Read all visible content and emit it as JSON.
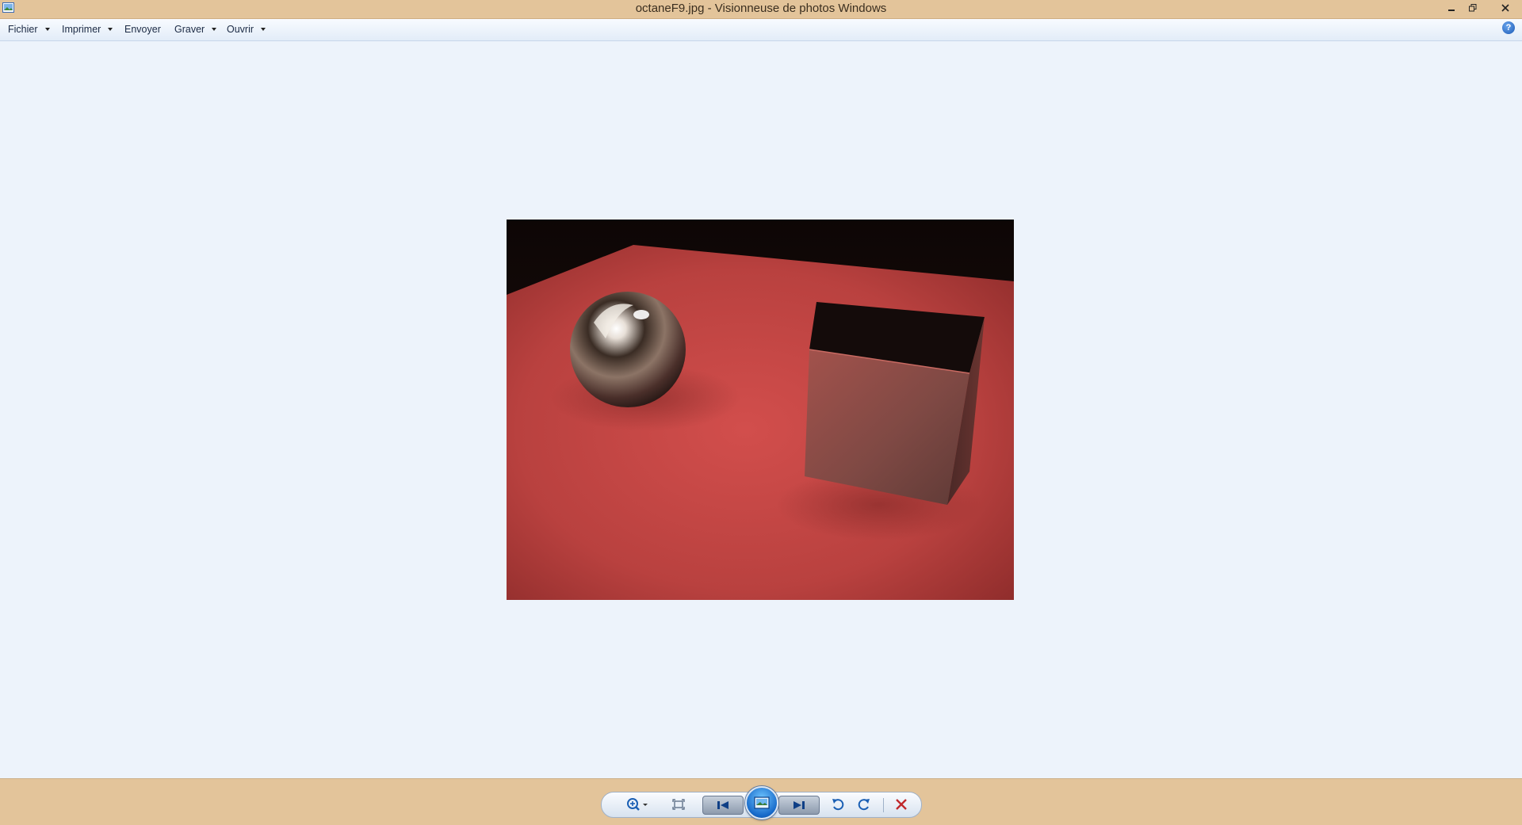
{
  "window": {
    "title": "octaneF9.jpg - Visionneuse de photos Windows",
    "icons": {
      "app": "photo-viewer-icon",
      "minimize": "minimize-icon",
      "maximize": "restore-icon",
      "close": "close-icon"
    }
  },
  "menu": {
    "items": [
      {
        "label": "Fichier",
        "has_dropdown": true
      },
      {
        "label": "Imprimer",
        "has_dropdown": true
      },
      {
        "label": "Envoyer",
        "has_dropdown": false
      },
      {
        "label": "Graver",
        "has_dropdown": true
      },
      {
        "label": "Ouvrir",
        "has_dropdown": true
      }
    ],
    "help": "?"
  },
  "photo": {
    "file": "octaneF9.jpg",
    "content": "render-scene-red-plane-chrome-sphere-cube"
  },
  "toolbar": {
    "buttons": [
      {
        "name": "zoom",
        "icon": "magnifier-icon"
      },
      {
        "name": "actual-size",
        "icon": "fit-window-icon"
      },
      {
        "name": "previous",
        "icon": "previous-icon"
      },
      {
        "name": "slideshow",
        "icon": "slideshow-icon"
      },
      {
        "name": "next",
        "icon": "next-icon"
      },
      {
        "name": "rotate-left",
        "icon": "rotate-ccw-icon"
      },
      {
        "name": "rotate-right",
        "icon": "rotate-cw-icon"
      },
      {
        "name": "delete",
        "icon": "delete-icon"
      }
    ]
  },
  "colors": {
    "chrome": "#e3c49a",
    "background": "#edf3fb",
    "delete": "#c0282c",
    "accent": "#1a5fb4"
  }
}
